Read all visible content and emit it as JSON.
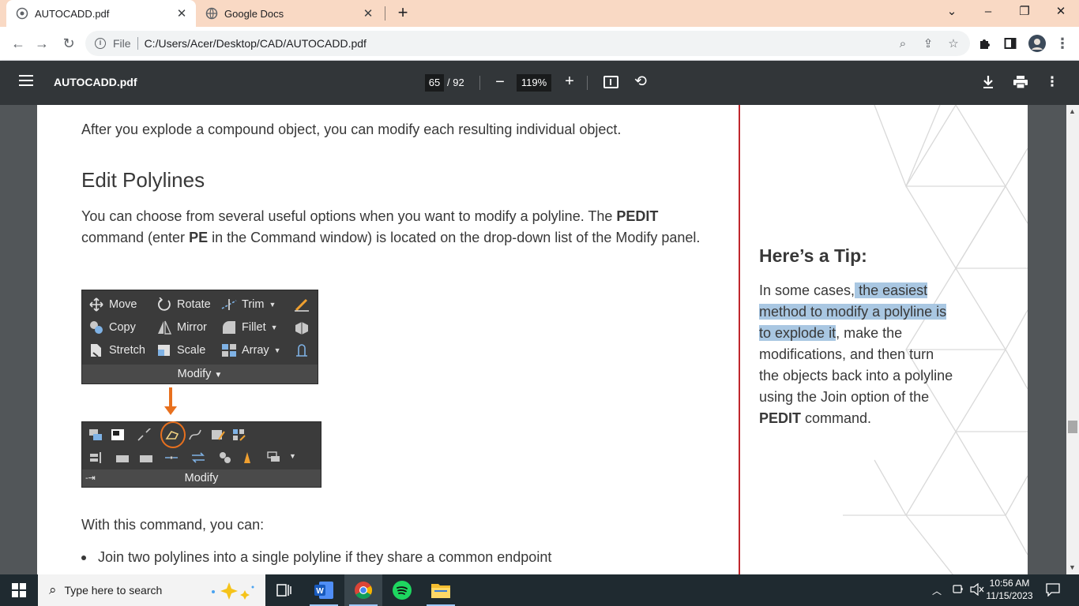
{
  "browser": {
    "tabs": [
      {
        "title": "AUTOCADD.pdf",
        "icon": "globe-icon",
        "active": true
      },
      {
        "title": "Google Docs",
        "icon": "globe-icon",
        "active": false
      }
    ],
    "new_tab": "+",
    "address": {
      "scheme_label": "File",
      "url": "C:/Users/Acer/Desktop/CAD/AUTOCADD.pdf"
    }
  },
  "pdf_toolbar": {
    "title": "AUTOCADD.pdf",
    "page_current": "65",
    "page_total": "/ 92",
    "zoom": "119%"
  },
  "document": {
    "p_explode": "After you explode a compound object, you can modify each resulting individual object.",
    "heading": "Edit Polylines",
    "p_intro_1": "You can choose from several useful options when you want to modify a polyline. The ",
    "p_intro_bold1": "PEDIT",
    "p_intro_2": " command (enter ",
    "p_intro_bold2": "PE",
    "p_intro_3": " in the Command window) is located on the drop-down list of the Modify panel.",
    "p_with": "With this command, you can:",
    "bullet_1": "Join two polylines into a single polyline if they share a common endpoint",
    "modify_panel": {
      "items": [
        "Move",
        "Rotate",
        "Trim",
        "Copy",
        "Mirror",
        "Fillet",
        "Stretch",
        "Scale",
        "Array"
      ],
      "title": "Modify"
    },
    "modify_panel_expanded_title": "Modify",
    "tip": {
      "title": "Here’s a Tip:",
      "t1": "In some cases,",
      "t2_hl": " the easiest method to modify a polyline is to explode it",
      "t3": ", make the modifications, and then turn the objects back into a polyline using the Join option of the ",
      "t4_bold": "PEDIT",
      "t5": " command."
    }
  },
  "taskbar": {
    "search_placeholder": "Type here to search",
    "time": "10:56 AM",
    "date": "11/15/2023"
  },
  "colors": {
    "tab_strip": "#f9d9c4",
    "pdf_toolbar": "#323639",
    "divider": "#c0272d",
    "highlight": "#a9c7e2",
    "callout_arrow": "#e8701e"
  }
}
